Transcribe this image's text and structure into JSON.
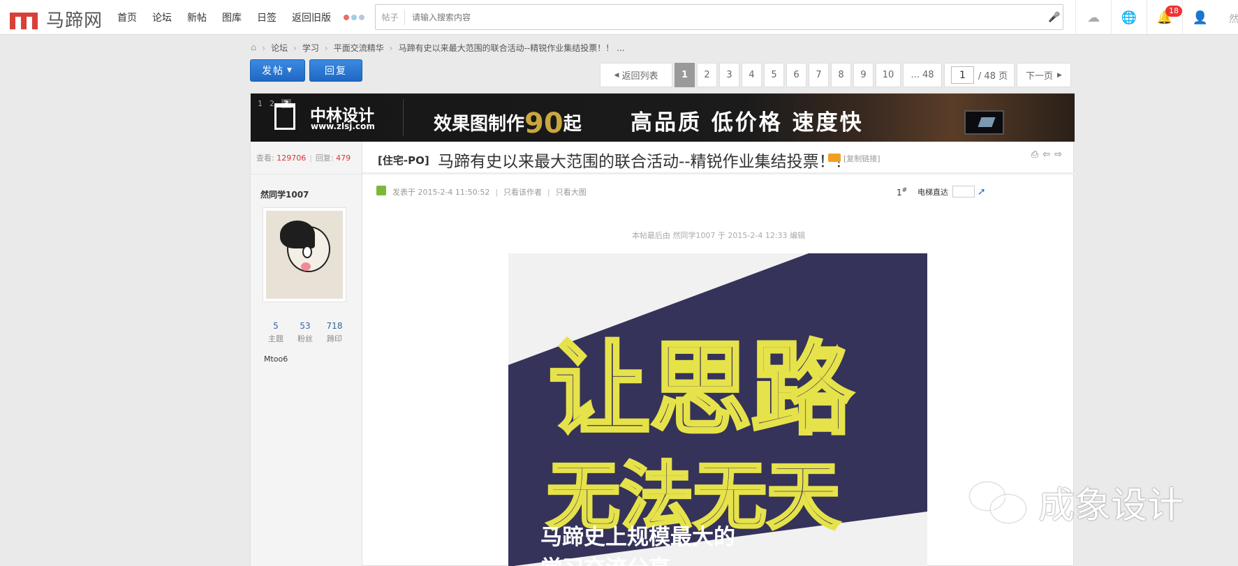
{
  "logo": {
    "text": "马蹄网"
  },
  "nav": [
    "首页",
    "论坛",
    "新帖",
    "图库",
    "日签",
    "返回旧版"
  ],
  "search": {
    "scope": "帖子",
    "placeholder": "请输入搜索内容"
  },
  "notifications": {
    "count": "18"
  },
  "topbar_cut_text": "然",
  "breadcrumb": [
    "论坛",
    "学习",
    "平面交流精华",
    "马蹄有史以来最大范围的联合活动--精锐作业集结投票！！ ..."
  ],
  "buttons": {
    "post": "发帖",
    "reply": "回复"
  },
  "pagination": {
    "back": "返回列表",
    "pages": [
      "1",
      "2",
      "3",
      "4",
      "5",
      "6",
      "7",
      "8",
      "9",
      "10",
      "... 48"
    ],
    "current_input": "1",
    "total": "/ 48 页",
    "next": "下一页"
  },
  "ad": {
    "slides": [
      "1",
      "2",
      "3"
    ],
    "brand": "中林设计",
    "url": "www.zlsj.com",
    "line1_prefix": "效果图制作",
    "line1_num": "90",
    "line1_suffix": "起",
    "line2": "高品质 低价格 速度快"
  },
  "stats": {
    "views_label": "查看:",
    "views": "129706",
    "replies_label": "回复:",
    "replies": "479"
  },
  "thread": {
    "type": "[住宅-PO]",
    "title": "马蹄有史以来最大范围的联合活动--精锐作业集结投票！！",
    "copy_link": "[复制链接]"
  },
  "author": {
    "name": "然同学1007",
    "topics": "5",
    "topics_label": "主题",
    "fans": "53",
    "fans_label": "粉丝",
    "marks": "718",
    "marks_label": "蹄印",
    "custom_title": "Mtoo6"
  },
  "post": {
    "posted": "发表于 2015-2-4 11:50:52",
    "only_author": "只看该作者",
    "only_images": "只看大图",
    "floor": "1",
    "floor_mark": "#",
    "jump_label": "电梯直达",
    "edited": "本帖最后由 然同学1007 于 2015-2-4 12:33 编辑"
  },
  "poster": {
    "line1": "让思路",
    "line2": "无法无天",
    "line3": "马蹄史上规模最大的",
    "line4": "学习交流分享",
    "bg_color": "#35335a",
    "text_color": "#e6e24a"
  },
  "watermark": {
    "text": "成象设计"
  },
  "colors": {
    "accent": "#1f68c4",
    "badge": "#e33333",
    "link": "#336699"
  }
}
